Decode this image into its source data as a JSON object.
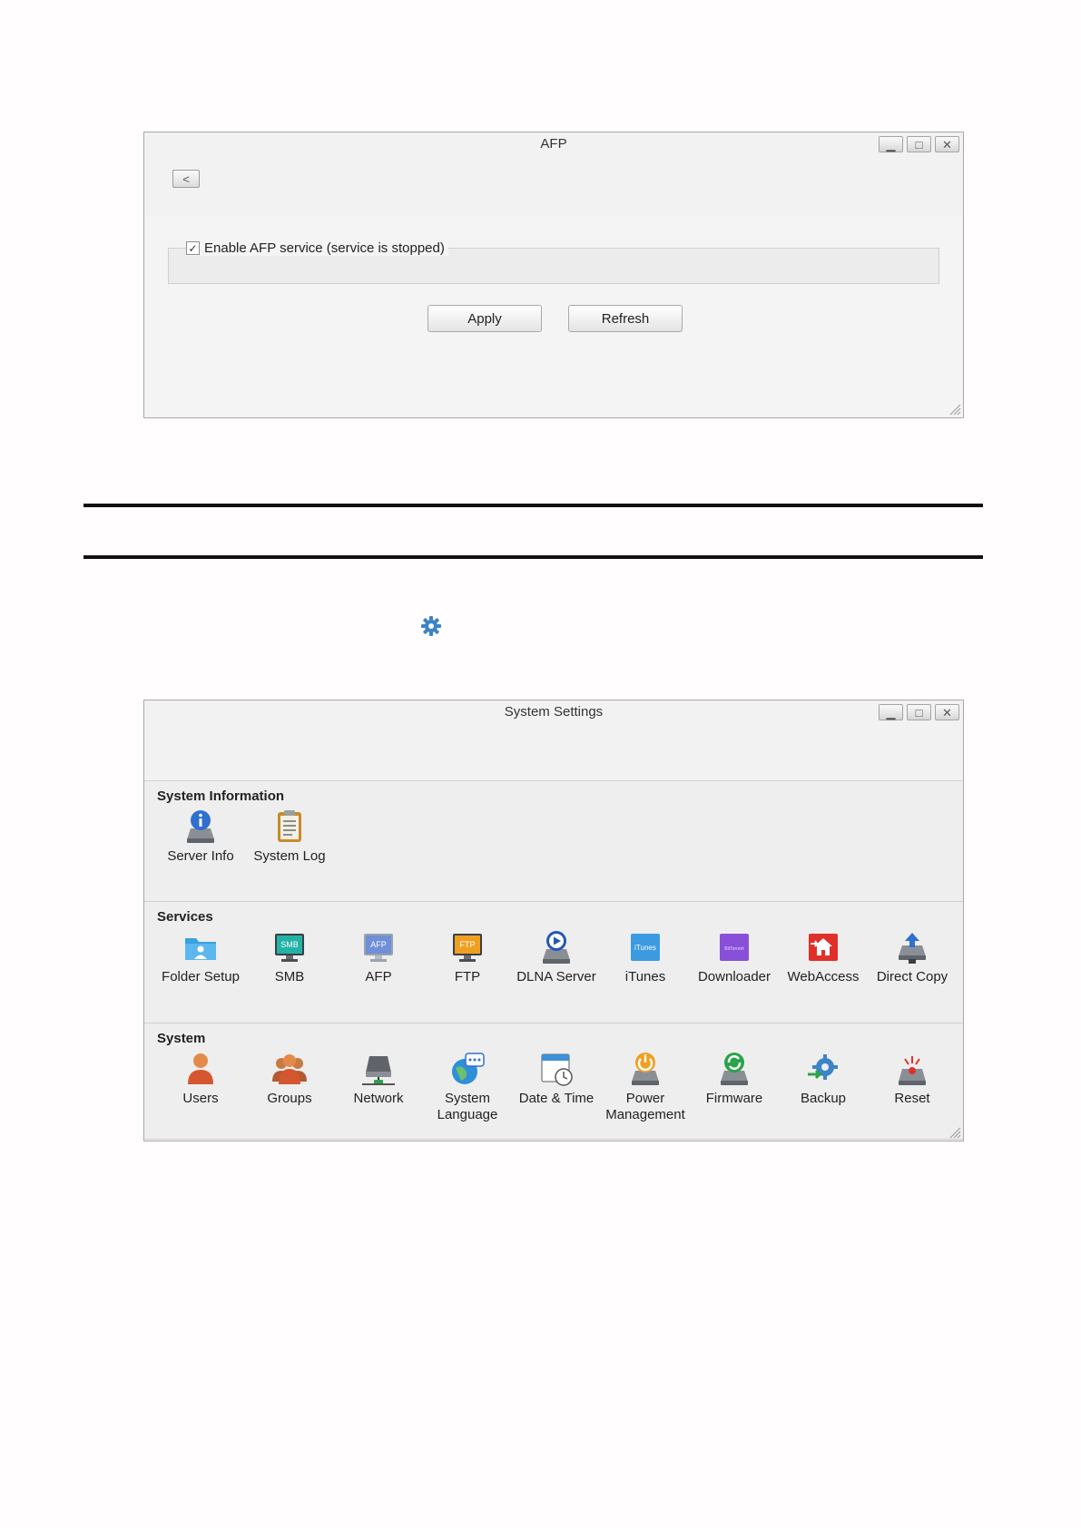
{
  "afp_window": {
    "title": "AFP",
    "back_label": "<",
    "enable_label": "Enable AFP service (service is stopped)",
    "apply_label": "Apply",
    "refresh_label": "Refresh"
  },
  "system_window": {
    "title": "System Settings",
    "sections": [
      {
        "title": "System Information",
        "items": [
          {
            "label": "Server Info",
            "icon": "server-info-icon"
          },
          {
            "label": "System Log",
            "icon": "system-log-icon"
          }
        ]
      },
      {
        "title": "Services",
        "items": [
          {
            "label": "Folder Setup",
            "icon": "folder-setup-icon"
          },
          {
            "label": "SMB",
            "icon": "smb-icon",
            "badge": "SMB"
          },
          {
            "label": "AFP",
            "icon": "afp-icon",
            "badge": "AFP"
          },
          {
            "label": "FTP",
            "icon": "ftp-icon",
            "badge": "FTP"
          },
          {
            "label": "DLNA Server",
            "icon": "dlna-server-icon"
          },
          {
            "label": "iTunes",
            "icon": "itunes-icon",
            "badge": "iTunes"
          },
          {
            "label": "Downloader",
            "icon": "downloader-icon",
            "badge": "BitTorrent"
          },
          {
            "label": "WebAccess",
            "icon": "webaccess-icon"
          },
          {
            "label": "Direct Copy",
            "icon": "direct-copy-icon"
          }
        ]
      },
      {
        "title": "System",
        "items": [
          {
            "label": "Users",
            "icon": "users-icon"
          },
          {
            "label": "Groups",
            "icon": "groups-icon"
          },
          {
            "label": "Network",
            "icon": "network-icon"
          },
          {
            "label": "System Language",
            "label_lines": [
              "System",
              "Language"
            ],
            "icon": "system-language-icon"
          },
          {
            "label": "Date & Time",
            "icon": "date-time-icon"
          },
          {
            "label": "Power Management",
            "label_lines": [
              "Power",
              "Management"
            ],
            "icon": "power-management-icon"
          },
          {
            "label": "Firmware",
            "icon": "firmware-icon"
          },
          {
            "label": "Backup",
            "icon": "backup-icon"
          },
          {
            "label": "Reset",
            "icon": "reset-icon"
          }
        ]
      }
    ]
  },
  "colors": {
    "window_bg": "#f3f3f3",
    "section_bg": "#eeeeee",
    "gear_blue": "#3d83c8"
  }
}
